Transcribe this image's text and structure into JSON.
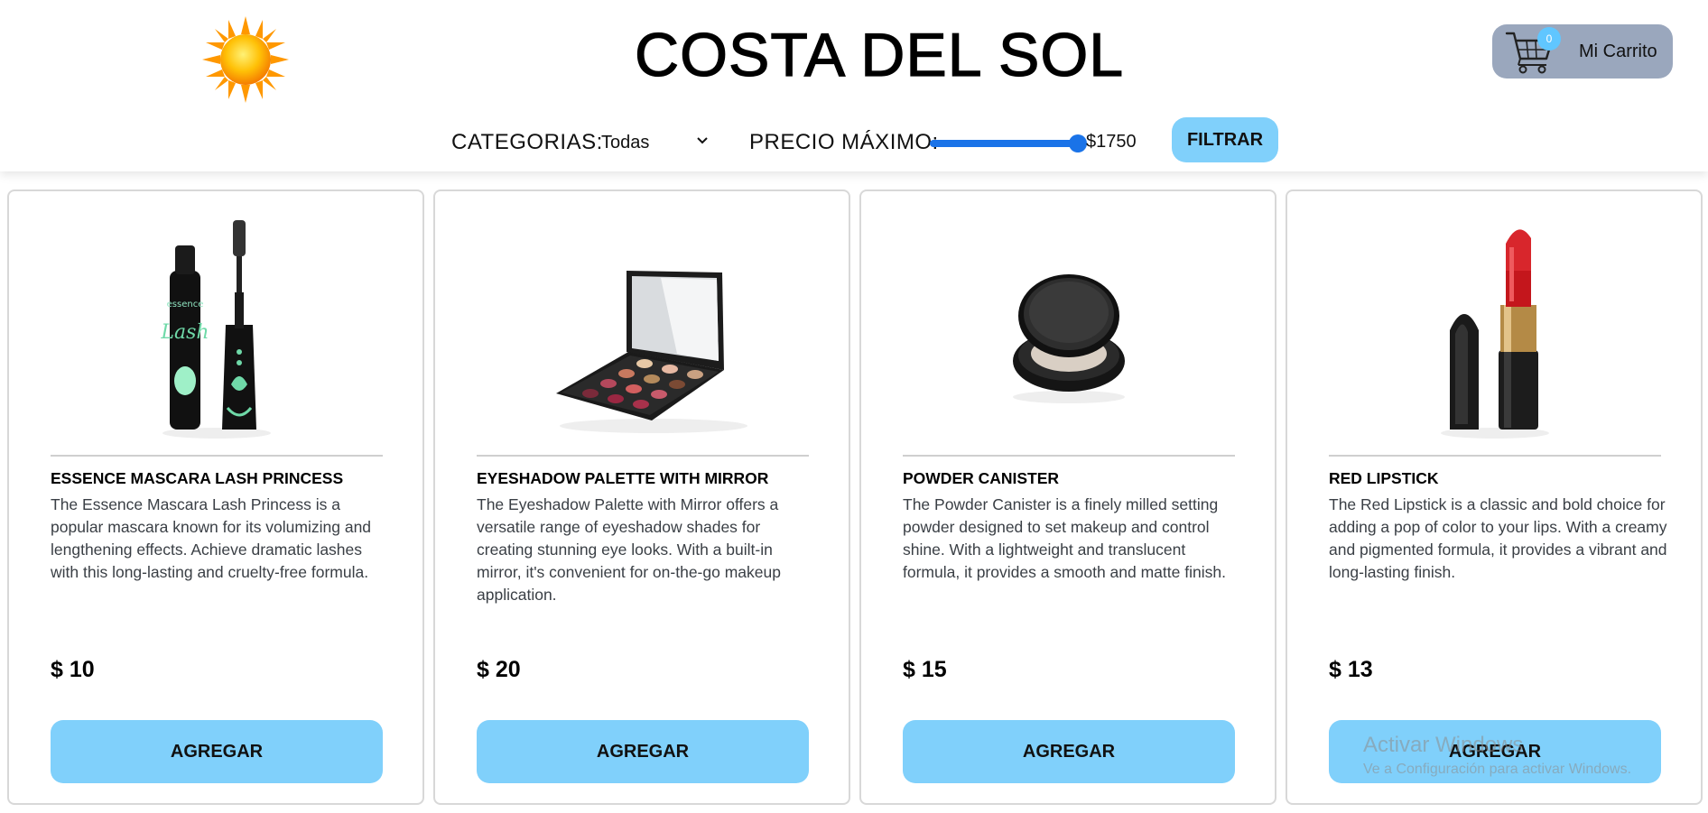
{
  "header": {
    "brand": "COSTA DEL SOL",
    "logo_icon": "sun-icon",
    "cart": {
      "count": "0",
      "label": "Mi Carrito",
      "icon": "shopping-cart-icon"
    }
  },
  "filters": {
    "category_label": "CATEGORIAS:",
    "category_value": "Todas",
    "price_label": "PRECIO MÁXIMO:",
    "price_value": "$1750",
    "price_fraction": 1.0,
    "filter_button": "FILTRAR"
  },
  "colors": {
    "accent": "#80d0fb",
    "slider": "#1a73e8",
    "cart_bg": "#9aa7bd",
    "badge": "#60c6ff"
  },
  "products": [
    {
      "name": "ESSENCE MASCARA LASH PRINCESS",
      "description": "The Essence Mascara Lash Princess is a popular mascara known for its volumizing and lengthening effects. Achieve dramatic lashes with this long-lasting and cruelty-free formula.",
      "price": "$ 10",
      "button": "AGREGAR",
      "image_icon": "mascara-image"
    },
    {
      "name": "EYESHADOW PALETTE WITH MIRROR",
      "description": "The Eyeshadow Palette with Mirror offers a versatile range of eyeshadow shades for creating stunning eye looks. With a built-in mirror, it's convenient for on-the-go makeup application.",
      "price": "$ 20",
      "button": "AGREGAR",
      "image_icon": "eyeshadow-palette-image"
    },
    {
      "name": "POWDER CANISTER",
      "description": "The Powder Canister is a finely milled setting powder designed to set makeup and control shine. With a lightweight and translucent formula, it provides a smooth and matte finish.",
      "price": "$ 15",
      "button": "AGREGAR",
      "image_icon": "powder-canister-image"
    },
    {
      "name": "RED LIPSTICK",
      "description": "The Red Lipstick is a classic and bold choice for adding a pop of color to your lips. With a creamy and pigmented formula, it provides a vibrant and long-lasting finish.",
      "price": "$ 13",
      "button": "AGREGAR",
      "image_icon": "lipstick-image"
    }
  ],
  "watermark": {
    "line1": "Activar Windows",
    "line2": "Ve a Configuración para activar Windows."
  }
}
